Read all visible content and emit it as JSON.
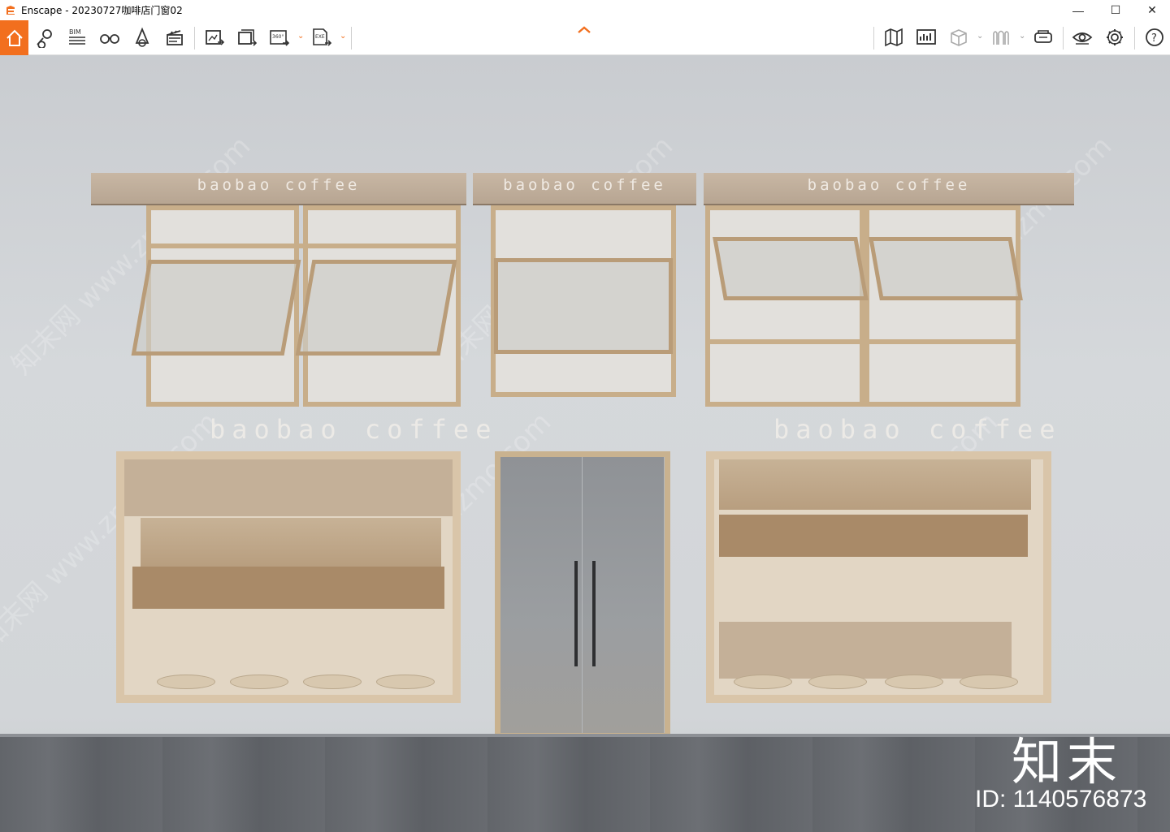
{
  "window": {
    "title": "Enscape - 20230727咖啡店门窗02",
    "minimize": "—",
    "maximize": "☐",
    "close": "✕"
  },
  "toolbar": {
    "left": [
      {
        "name": "home-button",
        "icon": "home-icon"
      },
      {
        "name": "views-button",
        "icon": "location-pin-icon"
      },
      {
        "name": "bim-button",
        "icon": "bim-icon",
        "label": "BIM"
      },
      {
        "name": "binoculars-button",
        "icon": "binoculars-icon"
      },
      {
        "name": "asset-library-button",
        "icon": "bell-shape-icon"
      },
      {
        "name": "video-editor-button",
        "icon": "clapperboard-icon"
      }
    ],
    "export": [
      {
        "name": "screenshot-button",
        "icon": "export-image-icon"
      },
      {
        "name": "batch-render-button",
        "icon": "batch-export-icon"
      },
      {
        "name": "panorama-button",
        "icon": "panorama-360-icon",
        "label": "360°"
      },
      {
        "name": "exe-export-button",
        "icon": "exe-export-icon",
        "label": "EXE"
      }
    ],
    "right": [
      {
        "name": "map-button",
        "icon": "map-icon"
      },
      {
        "name": "info-button",
        "icon": "presentation-icon"
      },
      {
        "name": "box-button",
        "icon": "cube-icon"
      },
      {
        "name": "material-button",
        "icon": "material-icon"
      },
      {
        "name": "vr-button",
        "icon": "vr-headset-icon"
      },
      {
        "name": "visual-settings-button",
        "icon": "eye-icon"
      },
      {
        "name": "settings-button",
        "icon": "gear-icon"
      },
      {
        "name": "help-button",
        "icon": "help-icon",
        "label": "?"
      }
    ]
  },
  "scene": {
    "awning_text": "baobao coffee",
    "wall_text": "baobao coffee"
  },
  "watermark": {
    "brand": "知末",
    "id": "ID: 1140576873",
    "faint": "知末网 www.znzmo.com"
  }
}
